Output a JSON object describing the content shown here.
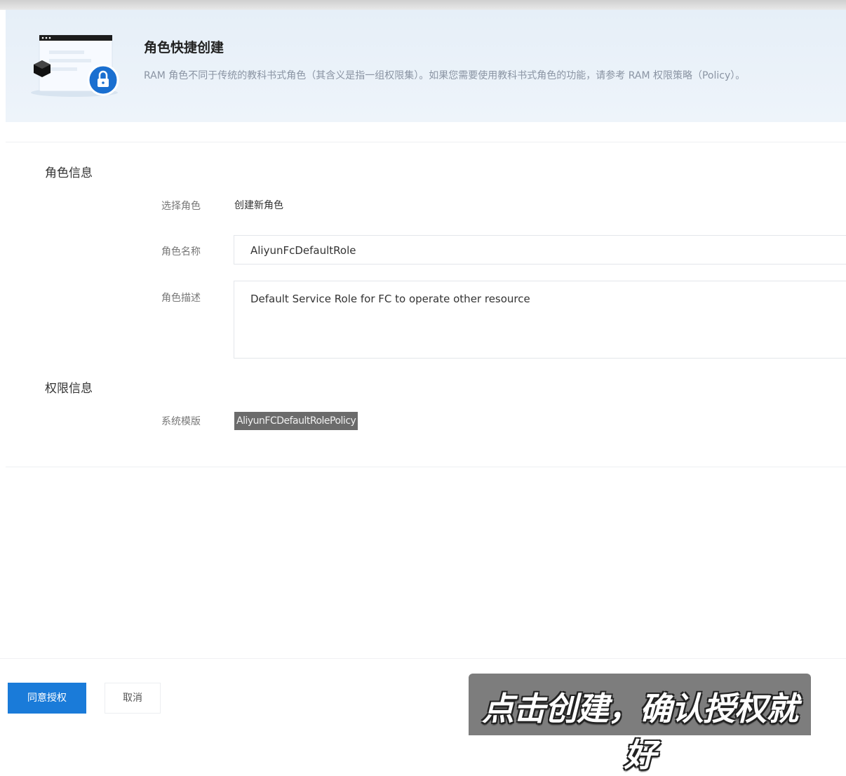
{
  "banner": {
    "title": "角色快捷创建",
    "description": "RAM 角色不同于传统的教科书式角色（其含义是指一组权限集）。如果您需要使用教科书式角色的功能，请参考 RAM 权限策略（Policy）。"
  },
  "role_info": {
    "section_title": "角色信息",
    "select_role_label": "选择角色",
    "select_role_value": "创建新角色",
    "role_name_label": "角色名称",
    "role_name_value": "AliyunFcDefaultRole",
    "role_desc_label": "角色描述",
    "role_desc_value": "Default Service Role for FC to operate other resource"
  },
  "permission_info": {
    "section_title": "权限信息",
    "template_label": "系统模版",
    "template_value": "AliyunFCDefaultRolePolicy"
  },
  "footer": {
    "agree_button": "同意授权",
    "cancel_button": "取消"
  },
  "subtitle": {
    "text": "点击创建，确认授权就好"
  },
  "colors": {
    "primary": "#1a7bd9",
    "banner_bg": "#e6eff8",
    "lock_badge": "#1a6fd0"
  }
}
